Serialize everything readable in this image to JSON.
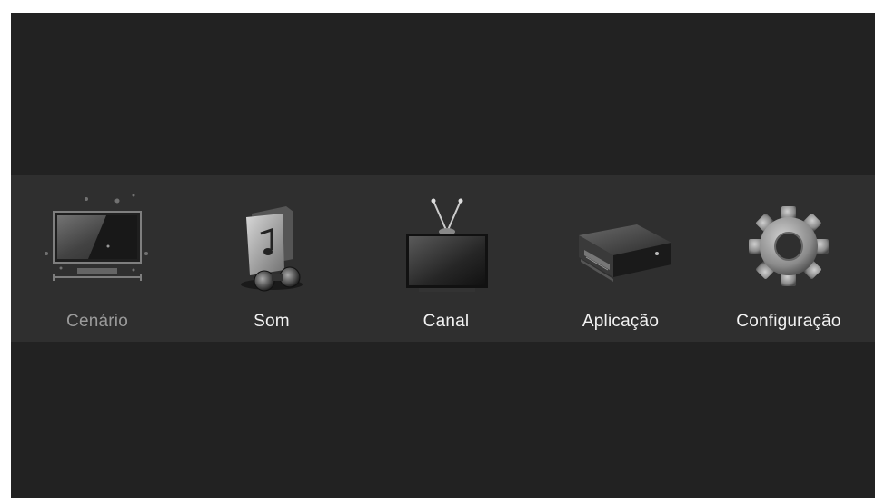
{
  "menu": {
    "selected_index": 0,
    "items": [
      {
        "label": "Cenário",
        "icon": "scene-icon"
      },
      {
        "label": "Som",
        "icon": "music-folder-icon"
      },
      {
        "label": "Canal",
        "icon": "tv-antenna-icon"
      },
      {
        "label": "Aplicação",
        "icon": "media-box-icon"
      },
      {
        "label": "Configuração",
        "icon": "gear-icon"
      }
    ]
  }
}
